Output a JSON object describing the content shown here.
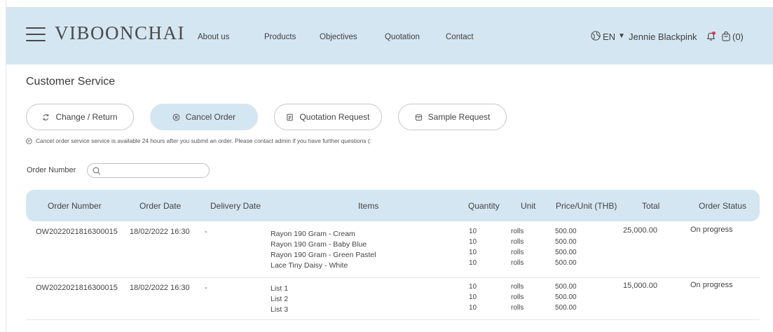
{
  "header": {
    "brand": "VIBOONCHAI",
    "nav": [
      "About us",
      "Products",
      "Objectives",
      "Quotation",
      "Contact"
    ],
    "language": "EN",
    "user_name": "Jennie Blackpink",
    "cart_count": "(0)",
    "accent_color": "#d4e6f1"
  },
  "page": {
    "title": "Customer Service",
    "tabs": [
      {
        "label": "Change / Return",
        "icon": "refresh-icon",
        "active": false
      },
      {
        "label": "Cancel Order",
        "icon": "cancel-circle-icon",
        "active": true
      },
      {
        "label": "Quotation Request",
        "icon": "document-icon",
        "active": false
      },
      {
        "label": "Sample Request",
        "icon": "box-icon",
        "active": false
      }
    ],
    "notice": "Cancel order service service is available 24 hours after you submit an order. Please contact admin if you have further questions (:",
    "search_label": "Order Number",
    "search_value": ""
  },
  "table": {
    "columns": [
      "Order Number",
      "Order Date",
      "Delivery Date",
      "Items",
      "Quantity",
      "Unit",
      "Price/Unit (THB)",
      "Total",
      "Order Status"
    ],
    "rows": [
      {
        "order_number": "OW2022021816300015",
        "order_date": "18/02/2022 16:30",
        "delivery_date": "-",
        "items": [
          "Rayon 190 Gram - Cream",
          "Rayon 190 Gram - Baby Blue",
          "Rayon 190 Gram - Green Pastel",
          "Lace Tiny Daisy - White"
        ],
        "quantities": [
          "10",
          "10",
          "10",
          "10"
        ],
        "units": [
          "rolls",
          "rolls",
          "rolls",
          "rolls"
        ],
        "prices": [
          "500.00",
          "500.00",
          "500.00",
          "500.00"
        ],
        "total": "25,000.00",
        "status": "On progress"
      },
      {
        "order_number": "OW2022021816300015",
        "order_date": "18/02/2022 16:30",
        "delivery_date": "-",
        "items": [
          "List 1",
          "List 2",
          "List 3"
        ],
        "quantities": [
          "10",
          "10",
          "10"
        ],
        "units": [
          "rolls",
          "rolls",
          "rolls"
        ],
        "prices": [
          "500.00",
          "500.00",
          "500.00"
        ],
        "total": "15,000.00",
        "status": "On progress"
      }
    ]
  }
}
